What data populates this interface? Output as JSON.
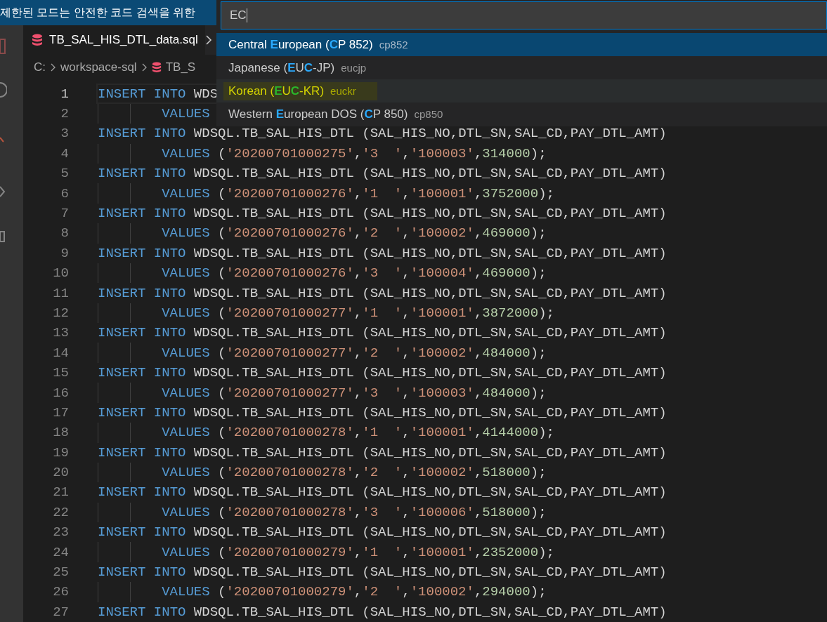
{
  "banner": {
    "text": "제한된 모드는 안전한 코드 검색을 위한"
  },
  "tab": {
    "label": "TB_SAL_HIS_DTL_data.sql",
    "selected": true
  },
  "breadcrumbs": [
    "C:",
    "workspace-sql",
    "TB_S"
  ],
  "quick_pick": {
    "value": "EC",
    "items": [
      {
        "label": [
          {
            "text": "Central ",
            "match": false
          },
          {
            "text": "E",
            "match": true
          },
          {
            "text": "uropean (",
            "match": false
          },
          {
            "text": "C",
            "match": true
          },
          {
            "text": "P 852)",
            "match": false
          }
        ],
        "description": "cp852",
        "selected": true,
        "highlighted": false
      },
      {
        "label": [
          {
            "text": "Japanese (",
            "match": false
          },
          {
            "text": "E",
            "match": true
          },
          {
            "text": "U",
            "match": false
          },
          {
            "text": "C",
            "match": true
          },
          {
            "text": "-JP)",
            "match": false
          }
        ],
        "description": "eucjp",
        "selected": false,
        "highlighted": false
      },
      {
        "label": [
          {
            "text": "Korean (",
            "match": false
          },
          {
            "text": "E",
            "match": true
          },
          {
            "text": "U",
            "match": false
          },
          {
            "text": "C",
            "match": true
          },
          {
            "text": "-KR)",
            "match": false
          }
        ],
        "description": "euckr",
        "selected": false,
        "highlighted": true
      },
      {
        "label": [
          {
            "text": "Western ",
            "match": false
          },
          {
            "text": "E",
            "match": true
          },
          {
            "text": "uropean DOS (",
            "match": false
          },
          {
            "text": "C",
            "match": true
          },
          {
            "text": "P 850)",
            "match": false
          }
        ],
        "description": "cp850",
        "selected": false,
        "highlighted": false
      }
    ]
  },
  "editor": {
    "lines": [
      {
        "num": "1",
        "kind": "insert",
        "current": true,
        "text": "INSERT INTO WDS"
      },
      {
        "num": "2",
        "kind": "values",
        "current": false,
        "text": "VALUES"
      },
      {
        "num": "3",
        "kind": "insert",
        "current": false,
        "text": "INSERT INTO WDSQL.TB_SAL_HIS_DTL (SAL_HIS_NO,DTL_SN,SAL_CD,PAY_DTL_AMT)"
      },
      {
        "num": "4",
        "kind": "values",
        "current": false,
        "text": "VALUES ('20200701000275','3  ','100003',314000);"
      },
      {
        "num": "5",
        "kind": "insert",
        "current": false,
        "text": "INSERT INTO WDSQL.TB_SAL_HIS_DTL (SAL_HIS_NO,DTL_SN,SAL_CD,PAY_DTL_AMT)"
      },
      {
        "num": "6",
        "kind": "values",
        "current": false,
        "text": "VALUES ('20200701000276','1  ','100001',3752000);"
      },
      {
        "num": "7",
        "kind": "insert",
        "current": false,
        "text": "INSERT INTO WDSQL.TB_SAL_HIS_DTL (SAL_HIS_NO,DTL_SN,SAL_CD,PAY_DTL_AMT)"
      },
      {
        "num": "8",
        "kind": "values",
        "current": false,
        "text": "VALUES ('20200701000276','2  ','100002',469000);"
      },
      {
        "num": "9",
        "kind": "insert",
        "current": false,
        "text": "INSERT INTO WDSQL.TB_SAL_HIS_DTL (SAL_HIS_NO,DTL_SN,SAL_CD,PAY_DTL_AMT)"
      },
      {
        "num": "10",
        "kind": "values",
        "current": false,
        "text": "VALUES ('20200701000276','3  ','100004',469000);"
      },
      {
        "num": "11",
        "kind": "insert",
        "current": false,
        "text": "INSERT INTO WDSQL.TB_SAL_HIS_DTL (SAL_HIS_NO,DTL_SN,SAL_CD,PAY_DTL_AMT)"
      },
      {
        "num": "12",
        "kind": "values",
        "current": false,
        "text": "VALUES ('20200701000277','1  ','100001',3872000);"
      },
      {
        "num": "13",
        "kind": "insert",
        "current": false,
        "text": "INSERT INTO WDSQL.TB_SAL_HIS_DTL (SAL_HIS_NO,DTL_SN,SAL_CD,PAY_DTL_AMT)"
      },
      {
        "num": "14",
        "kind": "values",
        "current": false,
        "text": "VALUES ('20200701000277','2  ','100002',484000);"
      },
      {
        "num": "15",
        "kind": "insert",
        "current": false,
        "text": "INSERT INTO WDSQL.TB_SAL_HIS_DTL (SAL_HIS_NO,DTL_SN,SAL_CD,PAY_DTL_AMT)"
      },
      {
        "num": "16",
        "kind": "values",
        "current": false,
        "text": "VALUES ('20200701000277','3  ','100003',484000);"
      },
      {
        "num": "17",
        "kind": "insert",
        "current": false,
        "text": "INSERT INTO WDSQL.TB_SAL_HIS_DTL (SAL_HIS_NO,DTL_SN,SAL_CD,PAY_DTL_AMT)"
      },
      {
        "num": "18",
        "kind": "values",
        "current": false,
        "text": "VALUES ('20200701000278','1  ','100001',4144000);"
      },
      {
        "num": "19",
        "kind": "insert",
        "current": false,
        "text": "INSERT INTO WDSQL.TB_SAL_HIS_DTL (SAL_HIS_NO,DTL_SN,SAL_CD,PAY_DTL_AMT)"
      },
      {
        "num": "20",
        "kind": "values",
        "current": false,
        "text": "VALUES ('20200701000278','2  ','100002',518000);"
      },
      {
        "num": "21",
        "kind": "insert",
        "current": false,
        "text": "INSERT INTO WDSQL.TB_SAL_HIS_DTL (SAL_HIS_NO,DTL_SN,SAL_CD,PAY_DTL_AMT)"
      },
      {
        "num": "22",
        "kind": "values",
        "current": false,
        "text": "VALUES ('20200701000278','3  ','100006',518000);"
      },
      {
        "num": "23",
        "kind": "insert",
        "current": false,
        "text": "INSERT INTO WDSQL.TB_SAL_HIS_DTL (SAL_HIS_NO,DTL_SN,SAL_CD,PAY_DTL_AMT)"
      },
      {
        "num": "24",
        "kind": "values",
        "current": false,
        "text": "VALUES ('20200701000279','1  ','100001',2352000);"
      },
      {
        "num": "25",
        "kind": "insert",
        "current": false,
        "text": "INSERT INTO WDSQL.TB_SAL_HIS_DTL (SAL_HIS_NO,DTL_SN,SAL_CD,PAY_DTL_AMT)"
      },
      {
        "num": "26",
        "kind": "values",
        "current": false,
        "text": "VALUES ('20200701000279','2  ','100002',294000);"
      },
      {
        "num": "27",
        "kind": "insert",
        "current": false,
        "text": "INSERT INTO WDSQL.TB_SAL_HIS_DTL (SAL_HIS_NO,DTL_SN,SAL_CD,PAY_DTL_AMT)"
      }
    ]
  }
}
